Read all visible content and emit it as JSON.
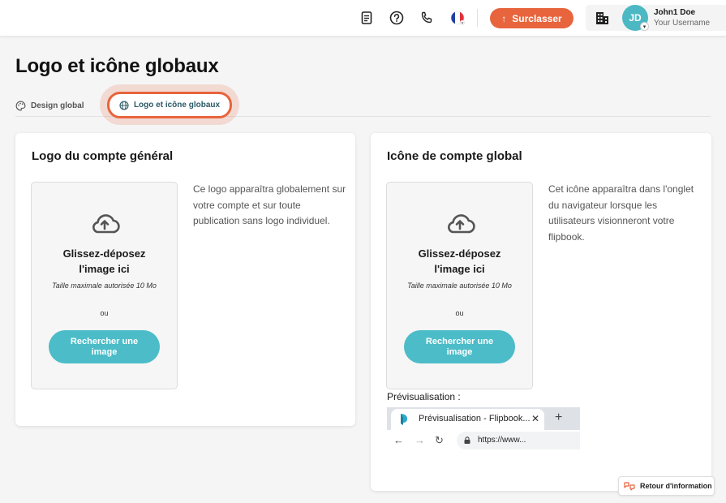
{
  "header": {
    "upgrade_label": "Surclasser",
    "user_initials": "JD",
    "user_name": "John1 Doe",
    "user_subtitle": "Your Username",
    "icons": [
      "document-icon",
      "help-icon",
      "phone-icon",
      "flag-fr-icon",
      "building-icon"
    ]
  },
  "page": {
    "title": "Logo et icône globaux"
  },
  "tabs": [
    {
      "label": "Design global",
      "icon": "palette-icon",
      "active": false
    },
    {
      "label": "Logo et icône globaux",
      "icon": "globe-icon",
      "active": true
    }
  ],
  "logo_card": {
    "title": "Logo du compte général",
    "drop_title": "Glissez-déposez l'image ici",
    "max_size": "Taille maximale autorisée 10 Mo",
    "or": "ou",
    "browse_label": "Rechercher une image",
    "description": "Ce logo apparaîtra globalement sur votre compte et sur toute publication sans logo individuel."
  },
  "icon_card": {
    "title": "Icône de compte global",
    "drop_title": "Glissez-déposez l'image ici",
    "max_size": "Taille maximale autorisée 10 Mo",
    "or": "ou",
    "browse_label": "Rechercher une image",
    "description": "Cet icône apparaîtra dans l'onglet du navigateur lorsque les utilisateurs visionneront votre flipbook.",
    "preview_label": "Prévisualisation :",
    "preview_tab_text": "Prévisualisation - Flipbook...",
    "preview_close": "✕",
    "preview_plus": "+",
    "preview_url": "https://www..."
  },
  "feedback_label": "Retour d'information",
  "colors": {
    "accent": "#e8643c",
    "teal": "#4bbcc8",
    "tab_active_text": "#2a5a66"
  }
}
